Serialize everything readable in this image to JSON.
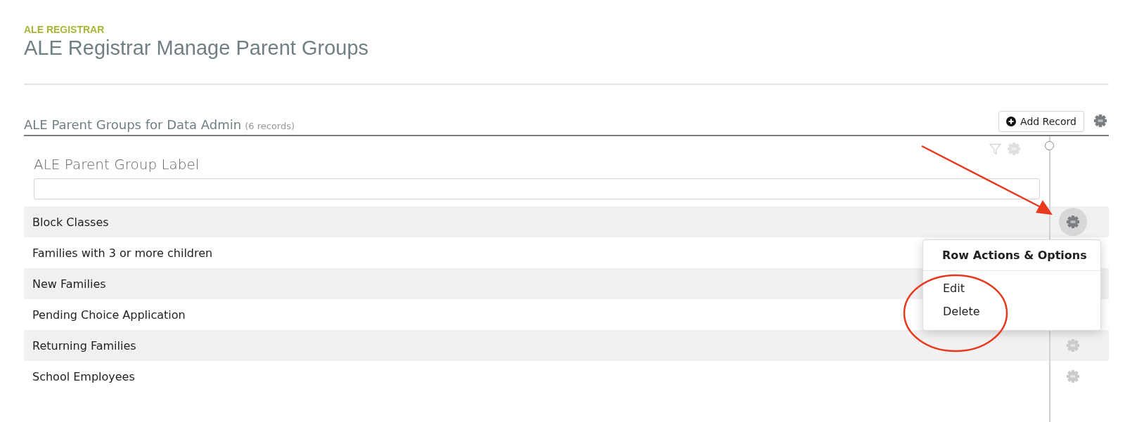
{
  "breadcrumb": "ALE REGISTRAR",
  "title": "ALE Registrar Manage Parent Groups",
  "section": {
    "title": "ALE Parent Groups for Data Admin",
    "count": "(6 records)"
  },
  "add_button": "Add Record",
  "column": {
    "label": "ALE Parent Group Label"
  },
  "rows": [
    {
      "label": "Block Classes",
      "menu": {
        "title": "Row Actions & Options",
        "items": [
          "Edit",
          "Delete"
        ]
      }
    },
    {
      "label": "Families with 3 or more children"
    },
    {
      "label": "New Families"
    },
    {
      "label": "Pending Choice Application"
    },
    {
      "label": "Returning Families"
    },
    {
      "label": "School Employees"
    }
  ]
}
